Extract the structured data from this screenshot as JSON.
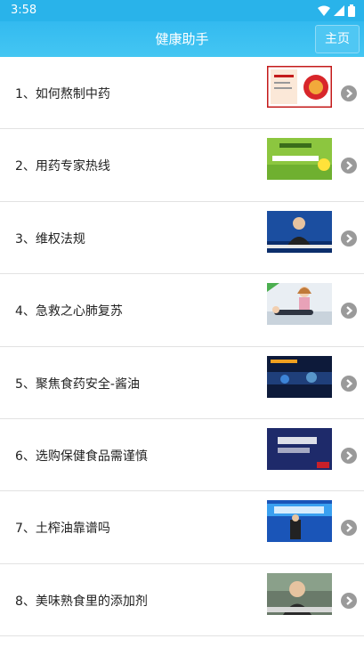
{
  "status": {
    "time": "3:58"
  },
  "header": {
    "title": "健康助手",
    "home_label": "主页"
  },
  "items": [
    {
      "label": "1、如何熬制中药",
      "thumb": "herbal-medicine-thumbnail"
    },
    {
      "label": "2、用药专家热线",
      "thumb": "hotline-thumbnail"
    },
    {
      "label": "3、维权法规",
      "thumb": "news-anchor-thumbnail"
    },
    {
      "label": "4、急救之心肺复苏",
      "thumb": "cpr-thumbnail"
    },
    {
      "label": "5、聚焦食药安全-酱油",
      "thumb": "soy-sauce-thumbnail"
    },
    {
      "label": "6、选购保健食品需谨慎",
      "thumb": "health-food-thumbnail"
    },
    {
      "label": "7、土榨油靠谱吗",
      "thumb": "oil-thumbnail"
    },
    {
      "label": "8、美味熟食里的添加剂",
      "thumb": "additive-thumbnail"
    }
  ],
  "colors": {
    "header": "#33baf0",
    "arrow": "#9a9a9a"
  }
}
